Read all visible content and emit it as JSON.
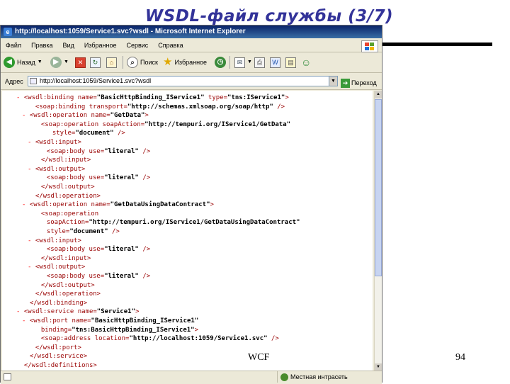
{
  "slide": {
    "title": "WSDL-файл службы (3/7)",
    "footer_left": "WCF",
    "page_number": "94"
  },
  "browser": {
    "window_title": "http://localhost:1059/Service1.svc?wsdl - Microsoft Internet Explorer",
    "menu": [
      "Файл",
      "Правка",
      "Вид",
      "Избранное",
      "Сервис",
      "Справка"
    ],
    "toolbar": {
      "back_label": "Назад",
      "search_label": "Поиск",
      "favorites_label": "Избранное"
    },
    "address_label": "Адрес",
    "address_value": "http://localhost:1059/Service1.svc?wsdl",
    "go_label": "Переход",
    "status_zone": "Местная интрасеть",
    "accent": "#0a246a"
  },
  "xml": [
    {
      "ind": 0,
      "mk": "-",
      "parts": [
        [
          "t",
          "<wsdl:binding "
        ],
        [
          "a",
          "name="
        ],
        [
          "v",
          "\"BasicHttpBinding_IService1\""
        ],
        [
          "a",
          " type="
        ],
        [
          "v",
          "\"tns:IService1\""
        ],
        [
          "t",
          ">"
        ]
      ]
    },
    {
      "ind": 2,
      "mk": "",
      "parts": [
        [
          "t",
          "<soap:binding "
        ],
        [
          "a",
          "transport="
        ],
        [
          "v",
          "\"http://schemas.xmlsoap.org/soap/http\""
        ],
        [
          "t",
          " />"
        ]
      ]
    },
    {
      "ind": 1,
      "mk": "-",
      "parts": [
        [
          "t",
          "<wsdl:operation "
        ],
        [
          "a",
          "name="
        ],
        [
          "v",
          "\"GetData\""
        ],
        [
          "t",
          ">"
        ]
      ]
    },
    {
      "ind": 3,
      "mk": "",
      "parts": [
        [
          "t",
          "<soap:operation "
        ],
        [
          "a",
          "soapAction="
        ],
        [
          "v",
          "\"http://tempuri.org/IService1/GetData\""
        ]
      ]
    },
    {
      "ind": 5,
      "mk": "",
      "parts": [
        [
          "a",
          "style="
        ],
        [
          "v",
          "\"document\""
        ],
        [
          "t",
          " />"
        ]
      ]
    },
    {
      "ind": 2,
      "mk": "-",
      "parts": [
        [
          "t",
          "<wsdl:input>"
        ]
      ]
    },
    {
      "ind": 4,
      "mk": "",
      "parts": [
        [
          "t",
          "<soap:body "
        ],
        [
          "a",
          "use="
        ],
        [
          "v",
          "\"literal\""
        ],
        [
          "t",
          " />"
        ]
      ]
    },
    {
      "ind": 3,
      "mk": "",
      "parts": [
        [
          "t",
          "</wsdl:input>"
        ]
      ]
    },
    {
      "ind": 2,
      "mk": "-",
      "parts": [
        [
          "t",
          "<wsdl:output>"
        ]
      ]
    },
    {
      "ind": 4,
      "mk": "",
      "parts": [
        [
          "t",
          "<soap:body "
        ],
        [
          "a",
          "use="
        ],
        [
          "v",
          "\"literal\""
        ],
        [
          "t",
          " />"
        ]
      ]
    },
    {
      "ind": 3,
      "mk": "",
      "parts": [
        [
          "t",
          "</wsdl:output>"
        ]
      ]
    },
    {
      "ind": 2,
      "mk": "",
      "parts": [
        [
          "t",
          "</wsdl:operation>"
        ]
      ]
    },
    {
      "ind": 1,
      "mk": "-",
      "parts": [
        [
          "t",
          "<wsdl:operation "
        ],
        [
          "a",
          "name="
        ],
        [
          "v",
          "\"GetDataUsingDataContract\""
        ],
        [
          "t",
          ">"
        ]
      ]
    },
    {
      "ind": 3,
      "mk": "",
      "parts": [
        [
          "t",
          "<soap:operation"
        ]
      ]
    },
    {
      "ind": 4,
      "mk": "",
      "parts": [
        [
          "a",
          "soapAction="
        ],
        [
          "v",
          "\"http://tempuri.org/IService1/GetDataUsingDataContract\""
        ]
      ]
    },
    {
      "ind": 4,
      "mk": "",
      "parts": [
        [
          "a",
          "style="
        ],
        [
          "v",
          "\"document\""
        ],
        [
          "t",
          " />"
        ]
      ]
    },
    {
      "ind": 2,
      "mk": "-",
      "parts": [
        [
          "t",
          "<wsdl:input>"
        ]
      ]
    },
    {
      "ind": 4,
      "mk": "",
      "parts": [
        [
          "t",
          "<soap:body "
        ],
        [
          "a",
          "use="
        ],
        [
          "v",
          "\"literal\""
        ],
        [
          "t",
          " />"
        ]
      ]
    },
    {
      "ind": 3,
      "mk": "",
      "parts": [
        [
          "t",
          "</wsdl:input>"
        ]
      ]
    },
    {
      "ind": 2,
      "mk": "-",
      "parts": [
        [
          "t",
          "<wsdl:output>"
        ]
      ]
    },
    {
      "ind": 4,
      "mk": "",
      "parts": [
        [
          "t",
          "<soap:body "
        ],
        [
          "a",
          "use="
        ],
        [
          "v",
          "\"literal\""
        ],
        [
          "t",
          " />"
        ]
      ]
    },
    {
      "ind": 3,
      "mk": "",
      "parts": [
        [
          "t",
          "</wsdl:output>"
        ]
      ]
    },
    {
      "ind": 2,
      "mk": "",
      "parts": [
        [
          "t",
          "</wsdl:operation>"
        ]
      ]
    },
    {
      "ind": 1,
      "mk": "",
      "parts": [
        [
          "t",
          "</wsdl:binding>"
        ]
      ]
    },
    {
      "ind": 0,
      "mk": "-",
      "parts": [
        [
          "t",
          "<wsdl:service "
        ],
        [
          "a",
          "name="
        ],
        [
          "v",
          "\"Service1\""
        ],
        [
          "t",
          ">"
        ]
      ]
    },
    {
      "ind": 1,
      "mk": "-",
      "parts": [
        [
          "t",
          "<wsdl:port "
        ],
        [
          "a",
          "name="
        ],
        [
          "v",
          "\"BasicHttpBinding_IService1\""
        ]
      ]
    },
    {
      "ind": 3,
      "mk": "",
      "parts": [
        [
          "a",
          "binding="
        ],
        [
          "v",
          "\"tns:BasicHttpBinding_IService1\""
        ],
        [
          "t",
          ">"
        ]
      ]
    },
    {
      "ind": 3,
      "mk": "",
      "parts": [
        [
          "t",
          "<soap:address "
        ],
        [
          "a",
          "location="
        ],
        [
          "v",
          "\"http://localhost:1059/Service1.svc\""
        ],
        [
          "t",
          " />"
        ]
      ]
    },
    {
      "ind": 2,
      "mk": "",
      "parts": [
        [
          "t",
          "</wsdl:port>"
        ]
      ]
    },
    {
      "ind": 1,
      "mk": "",
      "parts": [
        [
          "t",
          "</wsdl:service>"
        ]
      ]
    },
    {
      "ind": 0,
      "mk": "",
      "parts": [
        [
          "t",
          "</wsdl:definitions>"
        ]
      ]
    }
  ]
}
